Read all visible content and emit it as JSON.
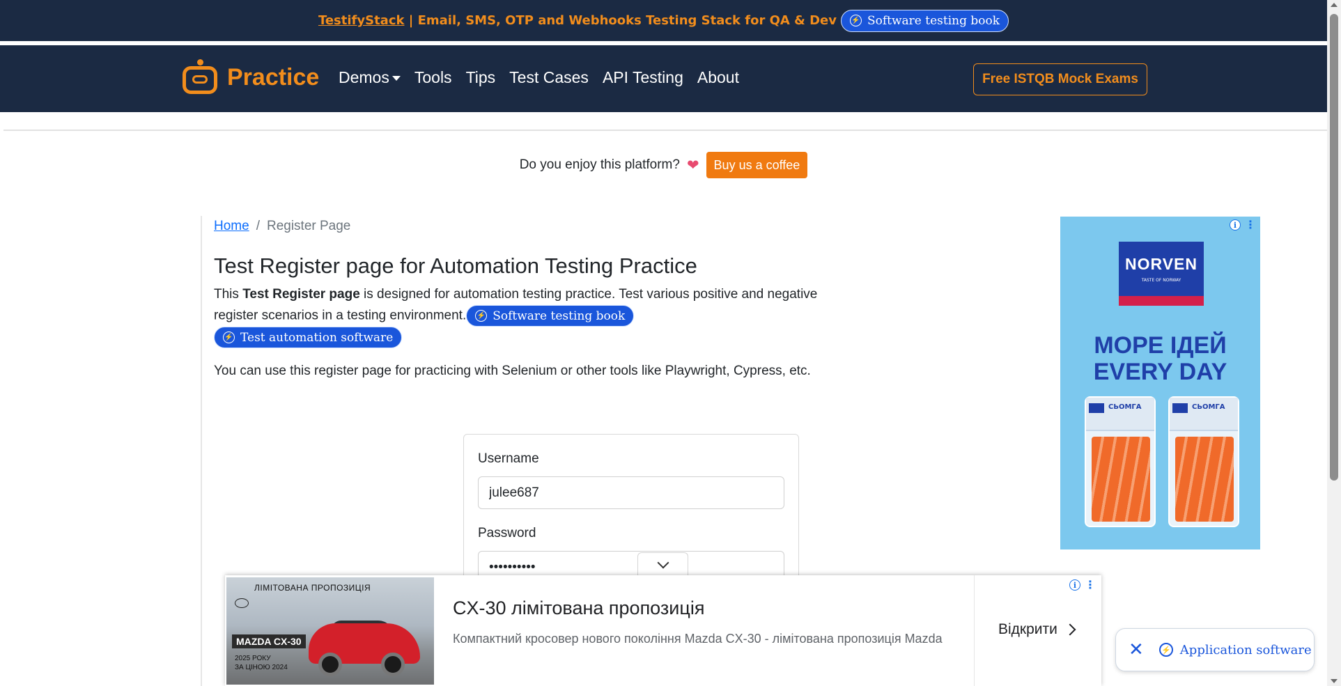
{
  "topbar": {
    "link_text": "TestifyStack",
    "text": " | Email, SMS, OTP and Webhooks Testing Stack for QA & Dev",
    "pill_label": "Software testing book"
  },
  "navbar": {
    "brand": "Practice",
    "items": [
      {
        "label": "Demos",
        "dropdown": true
      },
      {
        "label": "Tools"
      },
      {
        "label": "Tips"
      },
      {
        "label": "Test Cases"
      },
      {
        "label": "API Testing"
      },
      {
        "label": "About"
      }
    ],
    "cta": "Free ISTQB Mock Exams"
  },
  "support": {
    "text": "Do you enjoy this platform?",
    "heart_icon": "heart-icon",
    "button": "Buy us a coffee"
  },
  "breadcrumb": {
    "home": "Home",
    "separator": "/",
    "current": "Register Page"
  },
  "page": {
    "title": "Test Register page for Automation Testing Practice",
    "intro_prefix": "This ",
    "intro_bold": "Test Register page",
    "intro_suffix": " is designed for automation testing practice. Test various positive and negative register scenarios in a testing environment.",
    "pill_1": "Software testing book",
    "pill_2": "Test automation software",
    "usage": "You can use this register page for practicing with Selenium or other tools like Playwright, Cypress, etc."
  },
  "form": {
    "username_label": "Username",
    "username_value": "julee687",
    "password_label": "Password",
    "password_value": "••••••••••"
  },
  "side_ad": {
    "brand": "NORVEN",
    "brand_sub": "TASTE OF NORWAY",
    "headline_1": "МОРЕ ІДЕЙ",
    "headline_2": "EVERY DAY",
    "pack_label": "СЬОМГА"
  },
  "bottom_ad": {
    "image_promo": "ЛІМІТОВАНА ПРОПОЗИЦІЯ",
    "image_model": "MAZDA CX-30",
    "image_year": "2025 РОКУ\nЗА ЦІНОЮ 2024",
    "title": "CX-30 лімітована пропозиція",
    "description": "Компактний кросовер нового покоління Mazda CX-30 - лімітована пропозиція Mazda",
    "open_label": "Відкрити"
  },
  "floating": {
    "link_label": "Application software"
  },
  "colors": {
    "navy": "#1b2a43",
    "orange": "#f28d1c",
    "blue": "#1a56db"
  }
}
